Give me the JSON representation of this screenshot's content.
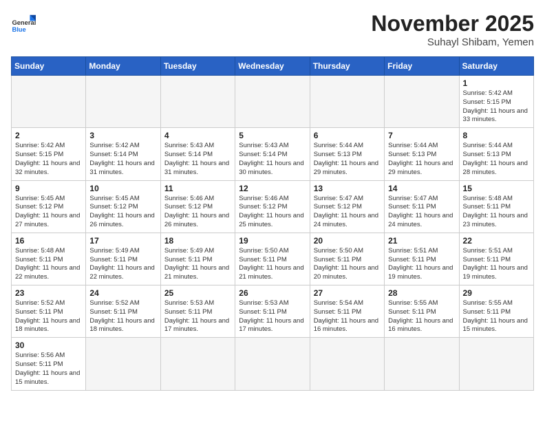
{
  "header": {
    "logo_general": "General",
    "logo_blue": "Blue",
    "month_title": "November 2025",
    "location": "Suhayl Shibam, Yemen"
  },
  "weekdays": [
    "Sunday",
    "Monday",
    "Tuesday",
    "Wednesday",
    "Thursday",
    "Friday",
    "Saturday"
  ],
  "days": [
    {
      "date": "",
      "empty": true
    },
    {
      "date": "",
      "empty": true
    },
    {
      "date": "",
      "empty": true
    },
    {
      "date": "",
      "empty": true
    },
    {
      "date": "",
      "empty": true
    },
    {
      "date": "",
      "empty": true
    },
    {
      "date": "1",
      "sunrise": "5:42 AM",
      "sunset": "5:15 PM",
      "daylight": "11 hours and 33 minutes."
    },
    {
      "date": "2",
      "sunrise": "5:42 AM",
      "sunset": "5:15 PM",
      "daylight": "11 hours and 32 minutes."
    },
    {
      "date": "3",
      "sunrise": "5:42 AM",
      "sunset": "5:14 PM",
      "daylight": "11 hours and 31 minutes."
    },
    {
      "date": "4",
      "sunrise": "5:43 AM",
      "sunset": "5:14 PM",
      "daylight": "11 hours and 31 minutes."
    },
    {
      "date": "5",
      "sunrise": "5:43 AM",
      "sunset": "5:14 PM",
      "daylight": "11 hours and 30 minutes."
    },
    {
      "date": "6",
      "sunrise": "5:44 AM",
      "sunset": "5:13 PM",
      "daylight": "11 hours and 29 minutes."
    },
    {
      "date": "7",
      "sunrise": "5:44 AM",
      "sunset": "5:13 PM",
      "daylight": "11 hours and 29 minutes."
    },
    {
      "date": "8",
      "sunrise": "5:44 AM",
      "sunset": "5:13 PM",
      "daylight": "11 hours and 28 minutes."
    },
    {
      "date": "9",
      "sunrise": "5:45 AM",
      "sunset": "5:12 PM",
      "daylight": "11 hours and 27 minutes."
    },
    {
      "date": "10",
      "sunrise": "5:45 AM",
      "sunset": "5:12 PM",
      "daylight": "11 hours and 26 minutes."
    },
    {
      "date": "11",
      "sunrise": "5:46 AM",
      "sunset": "5:12 PM",
      "daylight": "11 hours and 26 minutes."
    },
    {
      "date": "12",
      "sunrise": "5:46 AM",
      "sunset": "5:12 PM",
      "daylight": "11 hours and 25 minutes."
    },
    {
      "date": "13",
      "sunrise": "5:47 AM",
      "sunset": "5:12 PM",
      "daylight": "11 hours and 24 minutes."
    },
    {
      "date": "14",
      "sunrise": "5:47 AM",
      "sunset": "5:11 PM",
      "daylight": "11 hours and 24 minutes."
    },
    {
      "date": "15",
      "sunrise": "5:48 AM",
      "sunset": "5:11 PM",
      "daylight": "11 hours and 23 minutes."
    },
    {
      "date": "16",
      "sunrise": "5:48 AM",
      "sunset": "5:11 PM",
      "daylight": "11 hours and 22 minutes."
    },
    {
      "date": "17",
      "sunrise": "5:49 AM",
      "sunset": "5:11 PM",
      "daylight": "11 hours and 22 minutes."
    },
    {
      "date": "18",
      "sunrise": "5:49 AM",
      "sunset": "5:11 PM",
      "daylight": "11 hours and 21 minutes."
    },
    {
      "date": "19",
      "sunrise": "5:50 AM",
      "sunset": "5:11 PM",
      "daylight": "11 hours and 21 minutes."
    },
    {
      "date": "20",
      "sunrise": "5:50 AM",
      "sunset": "5:11 PM",
      "daylight": "11 hours and 20 minutes."
    },
    {
      "date": "21",
      "sunrise": "5:51 AM",
      "sunset": "5:11 PM",
      "daylight": "11 hours and 19 minutes."
    },
    {
      "date": "22",
      "sunrise": "5:51 AM",
      "sunset": "5:11 PM",
      "daylight": "11 hours and 19 minutes."
    },
    {
      "date": "23",
      "sunrise": "5:52 AM",
      "sunset": "5:11 PM",
      "daylight": "11 hours and 18 minutes."
    },
    {
      "date": "24",
      "sunrise": "5:52 AM",
      "sunset": "5:11 PM",
      "daylight": "11 hours and 18 minutes."
    },
    {
      "date": "25",
      "sunrise": "5:53 AM",
      "sunset": "5:11 PM",
      "daylight": "11 hours and 17 minutes."
    },
    {
      "date": "26",
      "sunrise": "5:53 AM",
      "sunset": "5:11 PM",
      "daylight": "11 hours and 17 minutes."
    },
    {
      "date": "27",
      "sunrise": "5:54 AM",
      "sunset": "5:11 PM",
      "daylight": "11 hours and 16 minutes."
    },
    {
      "date": "28",
      "sunrise": "5:55 AM",
      "sunset": "5:11 PM",
      "daylight": "11 hours and 16 minutes."
    },
    {
      "date": "29",
      "sunrise": "5:55 AM",
      "sunset": "5:11 PM",
      "daylight": "11 hours and 15 minutes."
    },
    {
      "date": "30",
      "sunrise": "5:56 AM",
      "sunset": "5:11 PM",
      "daylight": "11 hours and 15 minutes."
    },
    {
      "date": "",
      "empty": true
    },
    {
      "date": "",
      "empty": true
    },
    {
      "date": "",
      "empty": true
    },
    {
      "date": "",
      "empty": true
    },
    {
      "date": "",
      "empty": true
    },
    {
      "date": "",
      "empty": true
    }
  ]
}
